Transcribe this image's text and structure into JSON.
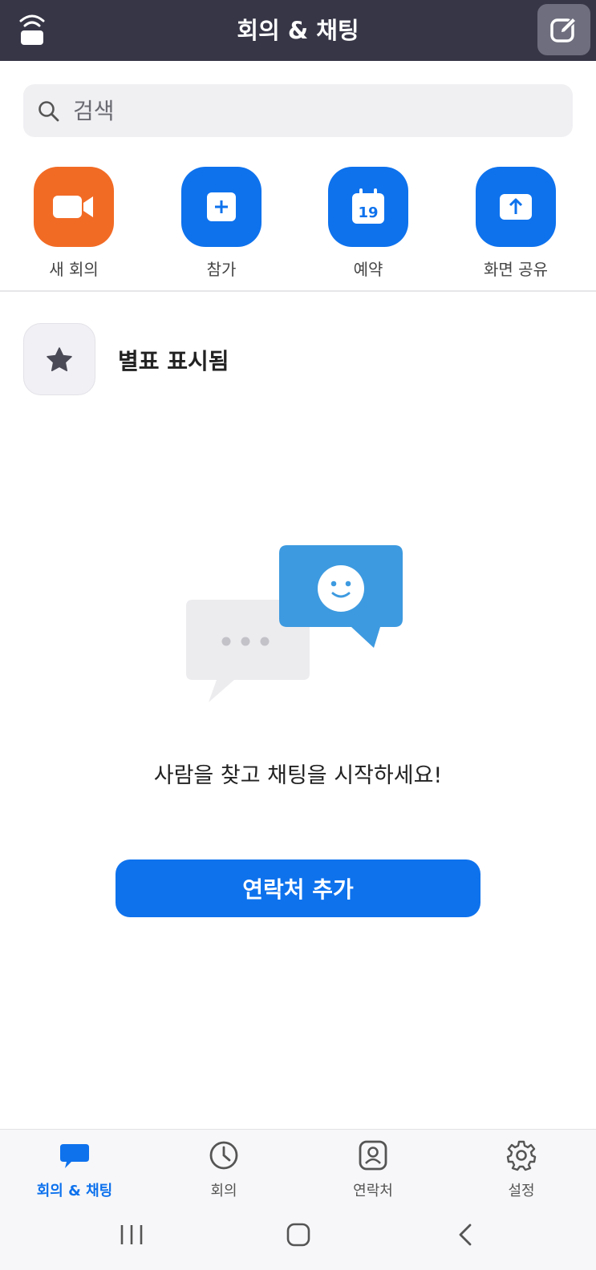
{
  "header": {
    "title": "회의 & 채팅"
  },
  "search": {
    "placeholder": "검색"
  },
  "actions": [
    {
      "label": "새 회의",
      "icon": "video-camera-icon",
      "color": "#f26b25"
    },
    {
      "label": "참가",
      "icon": "plus-icon",
      "color": "#0e72ed"
    },
    {
      "label": "예약",
      "icon": "calendar-icon",
      "color": "#0e72ed",
      "calendar_day": "19"
    },
    {
      "label": "화면 공유",
      "icon": "share-screen-icon",
      "color": "#0e72ed"
    }
  ],
  "starred": {
    "label": "별표 표시됨",
    "icon": "star-icon"
  },
  "empty_state": {
    "message": "사람을 찾고 채팅을 시작하세요!",
    "button_label": "연락처 추가"
  },
  "tabbar": [
    {
      "label": "회의 & 채팅",
      "icon": "chat-bubble-icon",
      "active": true
    },
    {
      "label": "회의",
      "icon": "clock-icon",
      "active": false
    },
    {
      "label": "연락처",
      "icon": "contact-icon",
      "active": false
    },
    {
      "label": "설정",
      "icon": "gear-icon",
      "active": false
    }
  ],
  "colors": {
    "header_bg": "#363647",
    "accent": "#0e72ed",
    "orange": "#f26b25"
  }
}
